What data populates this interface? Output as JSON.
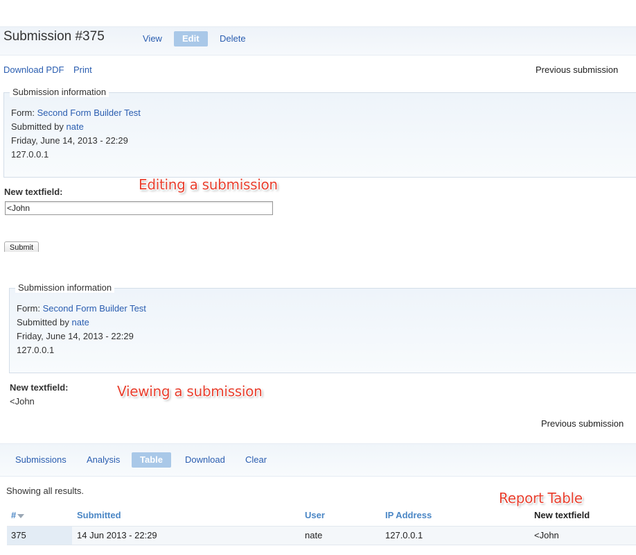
{
  "edit_view": {
    "title": "Submission #375",
    "tabs": [
      "View",
      "Edit",
      "Delete"
    ],
    "active_tab": "Edit",
    "links": {
      "download_pdf": "Download PDF",
      "print": "Print",
      "previous": "Previous submission"
    },
    "info": {
      "legend": "Submission information",
      "form_label": "Form:",
      "form_name": "Second Form Builder Test",
      "submitted_by_label": "Submitted by",
      "user": "nate",
      "date": "Friday, June 14, 2013 - 22:29",
      "ip": "127.0.0.1"
    },
    "field_label": "New textfield:",
    "field_value": "<John",
    "submit_label": "Submit",
    "annotation": "Editing a submission"
  },
  "view_view": {
    "info": {
      "legend": "Submission information",
      "form_label": "Form:",
      "form_name": "Second Form Builder Test",
      "submitted_by_label": "Submitted by",
      "user": "nate",
      "date": "Friday, June 14, 2013 - 22:29",
      "ip": "127.0.0.1"
    },
    "field_label": "New textfield:",
    "field_value": "<John",
    "annotation": "Viewing a submission",
    "previous": "Previous submission"
  },
  "report": {
    "tabs": [
      "Submissions",
      "Analysis",
      "Table",
      "Download",
      "Clear"
    ],
    "active_tab": "Table",
    "status": "Showing all results.",
    "annotation": "Report Table",
    "columns": [
      "#",
      "Submitted",
      "User",
      "IP Address",
      "New textfield"
    ],
    "rows": [
      {
        "id": "375",
        "submitted": "14 Jun 2013 - 22:29",
        "user": "nate",
        "ip": "127.0.0.1",
        "textfield": "<John"
      }
    ]
  },
  "colors": {
    "link": "#2a5db0",
    "active_tab": "#a9c8e8",
    "annotation": "#e8402f",
    "header_link": "#4a86c5"
  },
  "icons": {
    "sort": "sort-desc-icon"
  }
}
